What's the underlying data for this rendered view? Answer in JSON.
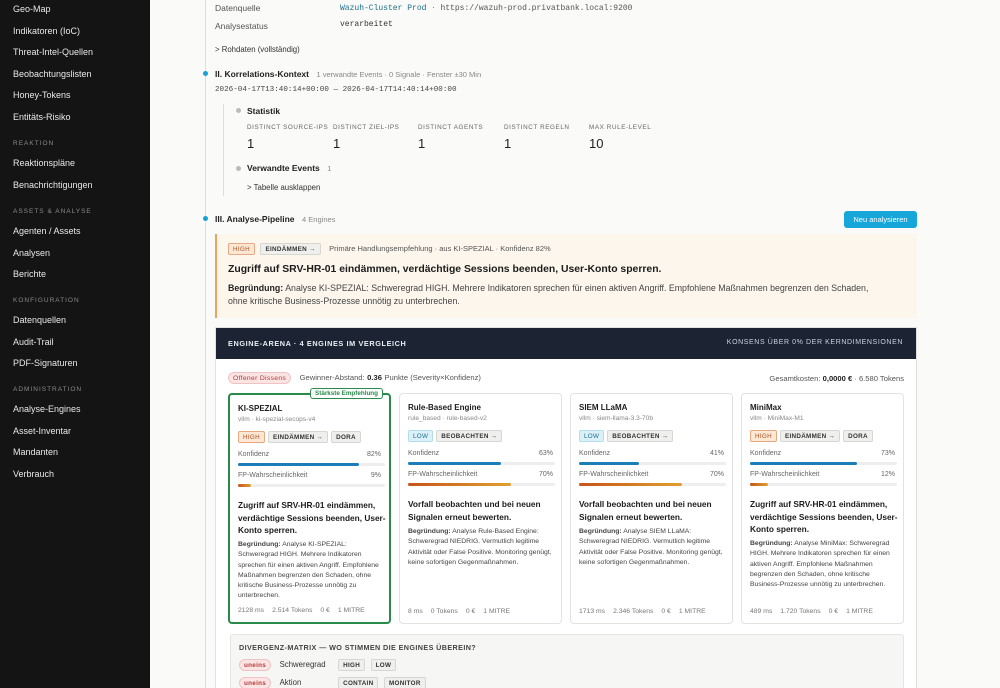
{
  "sidebar": {
    "items_top": [
      "Geo-Map",
      "Indikatoren (IoC)",
      "Threat-Intel-Quellen",
      "Beobachtungslisten",
      "Honey-Tokens",
      "Entitäts-Risiko"
    ],
    "sections": [
      {
        "heading": "Reaktion",
        "items": [
          "Reaktionspläne",
          "Benachrichtigungen"
        ]
      },
      {
        "heading": "Assets & Analyse",
        "items": [
          "Agenten / Assets",
          "Analysen",
          "Berichte"
        ]
      },
      {
        "heading": "Konfiguration",
        "items": [
          "Datenquellen",
          "Audit-Trail",
          "PDF-Signaturen"
        ]
      },
      {
        "heading": "Administration",
        "items": [
          "Analyse-Engines",
          "Asset-Inventar",
          "Mandanten",
          "Verbrauch"
        ]
      }
    ]
  },
  "source": {
    "label": "Datenquelle",
    "name": "Wazuh-Cluster Prod",
    "sep": "·",
    "url": "https://wazuh-prod.privatbank.local:9200",
    "status_label": "Analysestatus",
    "status_value": "verarbeitet",
    "raw_toggle": "> Rohdaten (vollständig)"
  },
  "correlation": {
    "title": "II. Korrelations-Kontext",
    "meta": "1 verwandte Events · 0 Signale · Fenster ±30 Min",
    "range": "2026-04-17T13:40:14+00:00 — 2026-04-17T14:40:14+00:00",
    "stats_title": "Statistik",
    "stats": [
      {
        "label": "Distinct Source-IPs",
        "value": "1"
      },
      {
        "label": "Distinct Ziel-IPs",
        "value": "1"
      },
      {
        "label": "Distinct Agents",
        "value": "1"
      },
      {
        "label": "Distinct Regeln",
        "value": "1"
      },
      {
        "label": "Max Rule-Level",
        "value": "10"
      }
    ],
    "related_title": "Verwandte Events",
    "related_count": "1",
    "table_toggle": "> Tabelle ausklappen"
  },
  "pipeline": {
    "title": "III. Analyse-Pipeline",
    "meta": "4 Engines",
    "reanalyze": "Neu analysieren"
  },
  "recommendation": {
    "severity": "HIGH",
    "action": "EINDÄMMEN →",
    "meta": "Primäre Handlungsempfehlung · aus KI-SPEZIAL · Konfidenz 82%",
    "headline": "Zugriff auf SRV-HR-01 eindämmen, verdächtige Sessions beenden, User-Konto sperren.",
    "reason_label": "Begründung:",
    "reason_line1": "Analyse KI-SPEZIAL: Schweregrad HIGH. Mehrere Indikatoren sprechen für einen aktiven Angriff. Empfohlene Maßnahmen begrenzen den Schaden,",
    "reason_line2": "ohne kritische Business-Prozesse unnötig zu unterbrechen."
  },
  "arena": {
    "title": "Engine-Arena · 4 Engines im Vergleich",
    "consensus": "Konsens über 0% der Kerndimensionen",
    "dissent_badge": "Offener Dissens",
    "gap_label": "Gewinner-Abstand:",
    "gap_value": "0.36",
    "gap_unit": "Punkte (Severity×Konfidenz)",
    "cost_label": "Gesamtkosten:",
    "cost_value": "0,0000 €",
    "cost_tokens": "· 6.580 Tokens",
    "best_badge": "Stärkste Empfehlung",
    "confidence_label": "Konfidenz",
    "fp_label": "FP-Wahrscheinlichkeit",
    "reason_label": "Begründung:",
    "cards": [
      {
        "name": "KI-SPEZIAL",
        "sub": "vllm · ki-spezial-secops-v4",
        "severity": "HIGH",
        "action": "EINDÄMMEN →",
        "extra": "DORA",
        "confidence": 82,
        "confidence_text": "82%",
        "fp": 9,
        "fp_text": "9%",
        "reco": "Zugriff auf SRV-HR-01 eindämmen, verdächtige Sessions beenden, User-Konto sperren.",
        "reason": "Analyse KI-SPEZIAL: Schweregrad HIGH. Mehrere Indikatoren sprechen für einen aktiven Angriff. Empfohlene Maßnahmen begrenzen den Schaden, ohne kritische Business-Prozesse unnötig zu unterbrechen.",
        "ms": "2128 ms",
        "tokens": "2.514 Tokens",
        "cost": "0 €",
        "mitre": "1 MITRE"
      },
      {
        "name": "Rule-Based Engine",
        "sub": "rule_based · rule-based-v2",
        "severity": "LOW",
        "action": "BEOBACHTEN →",
        "extra": "",
        "confidence": 63,
        "confidence_text": "63%",
        "fp": 70,
        "fp_text": "70%",
        "reco": "Vorfall beobachten und bei neuen Signalen erneut bewerten.",
        "reason": "Analyse Rule-Based Engine: Schweregrad NIEDRIG. Vermutlich legitime Aktivität oder False Positive. Monitoring genügt, keine sofortigen Gegenmaßnahmen.",
        "ms": "8 ms",
        "tokens": "0 Tokens",
        "cost": "0 €",
        "mitre": "1 MITRE"
      },
      {
        "name": "SIEM LLaMA",
        "sub": "vllm · siem-llama-3.3-70b",
        "severity": "LOW",
        "action": "BEOBACHTEN →",
        "extra": "",
        "confidence": 41,
        "confidence_text": "41%",
        "fp": 70,
        "fp_text": "70%",
        "reco": "Vorfall beobachten und bei neuen Signalen erneut bewerten.",
        "reason": "Analyse SIEM LLaMA: Schweregrad NIEDRIG. Vermutlich legitime Aktivität oder False Positive. Monitoring genügt, keine sofortigen Gegenmaßnahmen.",
        "ms": "1713 ms",
        "tokens": "2.346 Tokens",
        "cost": "0 €",
        "mitre": "1 MITRE"
      },
      {
        "name": "MiniMax",
        "sub": "vllm · MiniMax-M1",
        "severity": "HIGH",
        "action": "EINDÄMMEN →",
        "extra": "DORA",
        "confidence": 73,
        "confidence_text": "73%",
        "fp": 12,
        "fp_text": "12%",
        "reco": "Zugriff auf SRV-HR-01 eindämmen, verdächtige Sessions beenden, User-Konto sperren.",
        "reason": "Analyse MiniMax: Schweregrad HIGH. Mehrere Indikatoren sprechen für einen aktiven Angriff. Empfohlene Maßnahmen begrenzen den Schaden, ohne kritische Business-Prozesse unnötig zu unterbrechen.",
        "ms": "489 ms",
        "tokens": "1.720 Tokens",
        "cost": "0 €",
        "mitre": "1 MITRE"
      }
    ],
    "divergence": {
      "title": "Divergenz-Matrix — wo stimmen die Engines überein?",
      "rows": [
        {
          "status": "uneins",
          "dimension": "Schweregrad",
          "values": [
            "HIGH",
            "LOW"
          ]
        },
        {
          "status": "uneins",
          "dimension": "Aktion",
          "values": [
            "CONTAIN",
            "MONITOR"
          ]
        }
      ]
    }
  },
  "colors": {
    "accent": "#17a6d9",
    "confidence_bar": "#1a7fb8",
    "fp_bar_high": "#c7541a",
    "fp_bar_low": "#e0a030",
    "best_border": "#2a8a4a",
    "sidebar_bg": "#141414",
    "arena_header_bg": "#1c2433"
  }
}
